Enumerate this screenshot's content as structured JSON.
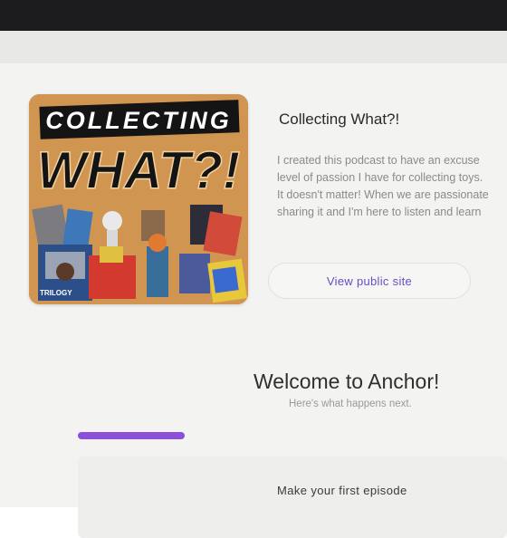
{
  "podcast": {
    "cover_text": {
      "line1": "COLLECTING",
      "line2": "WHAT?!",
      "figure_label": "TRILOGY"
    },
    "title": "Collecting What?!",
    "description_lines": [
      "I created this podcast to have an excuse",
      "level of passion I have for collecting toys.",
      "It doesn't matter! When we are passionate",
      "sharing it and I'm here to listen and learn"
    ],
    "view_public_site_label": "View public site"
  },
  "onboarding": {
    "title": "Welcome to Anchor!",
    "subtitle": "Here's what happens next.",
    "progress_fraction": 0.31,
    "progress_color": "#8a4fdb",
    "first_step_label": "Make your first episode"
  },
  "colors": {
    "accent": "#6a4cc4",
    "cover_background": "#c98a4a"
  }
}
